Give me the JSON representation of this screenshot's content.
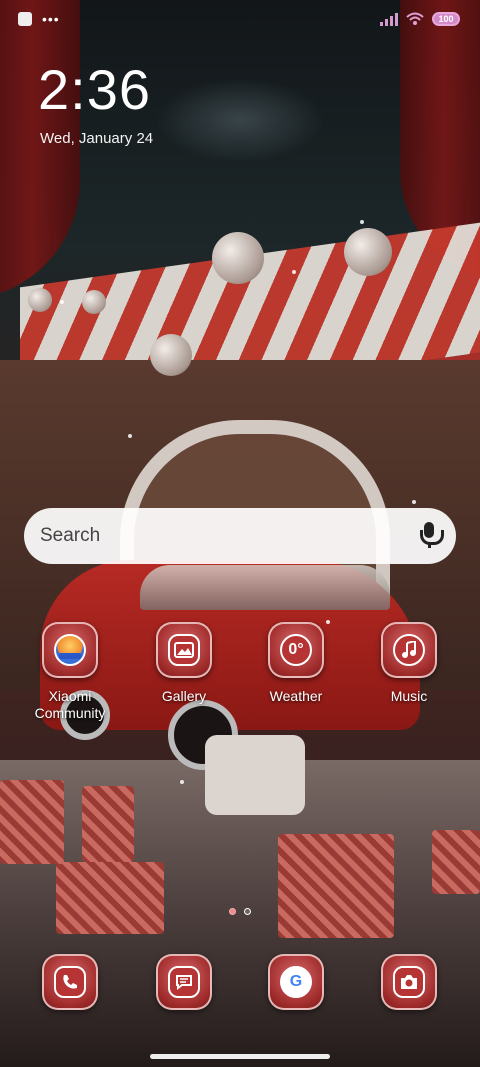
{
  "status_bar": {
    "battery": "100"
  },
  "lockclock": {
    "time": "2:36",
    "date": "Wed, January 24"
  },
  "search": {
    "placeholder": "Search"
  },
  "apps": [
    {
      "label": "Xiaomi Community",
      "icon": "xiaomi-community-icon"
    },
    {
      "label": "Gallery",
      "icon": "gallery-icon"
    },
    {
      "label": "Weather",
      "icon": "weather-icon",
      "badge": "0°"
    },
    {
      "label": "Music",
      "icon": "music-icon"
    }
  ],
  "dock": [
    {
      "icon": "phone-icon"
    },
    {
      "icon": "messages-icon"
    },
    {
      "icon": "google-icon"
    },
    {
      "icon": "camera-icon"
    }
  ],
  "pages": {
    "count": 2,
    "active": 1
  }
}
